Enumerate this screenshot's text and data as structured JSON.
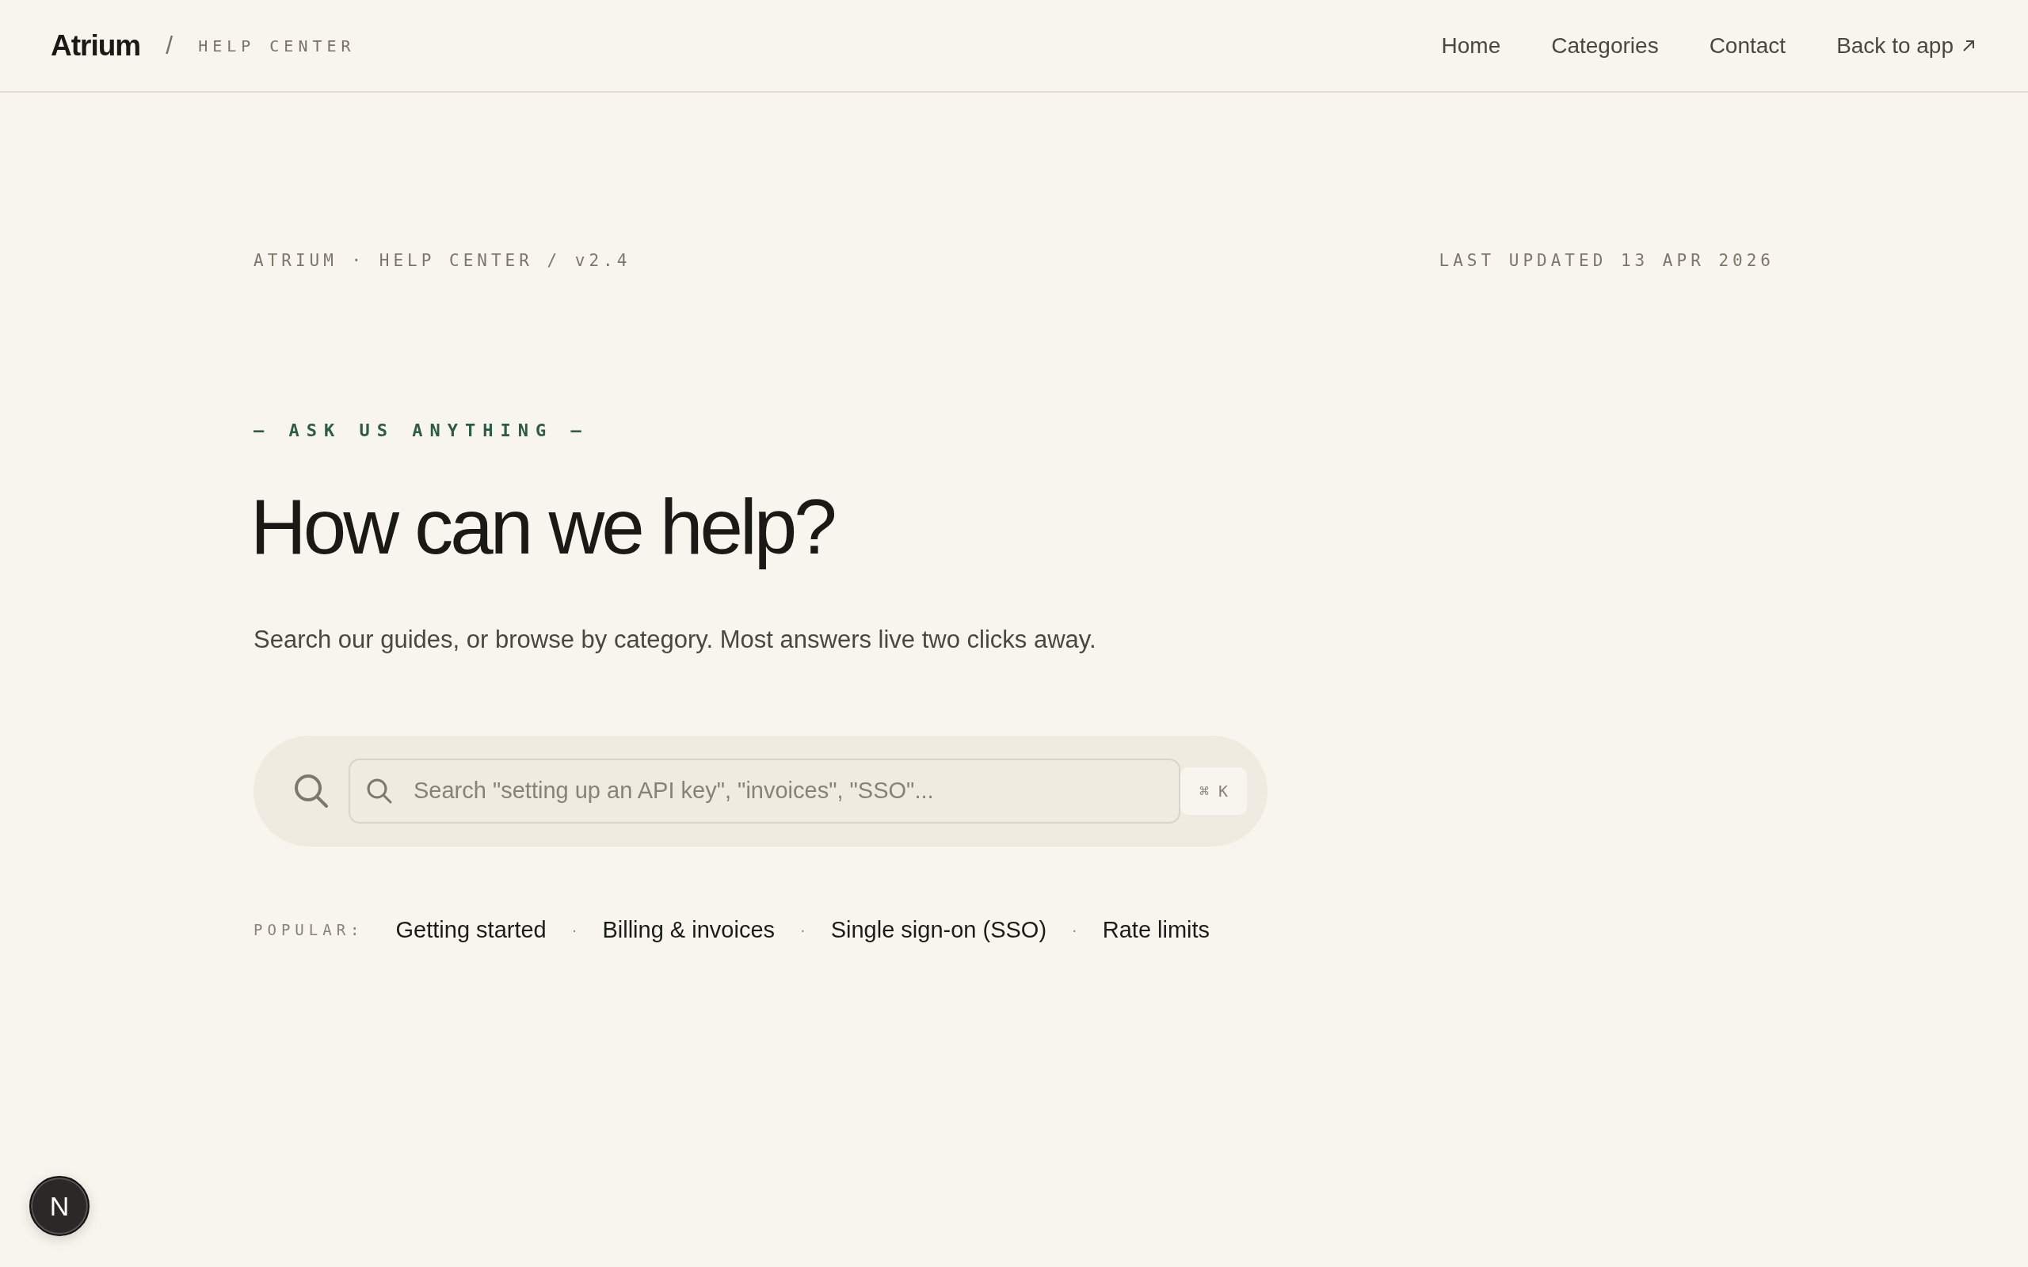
{
  "header": {
    "brand": "Atrium",
    "separator": "/",
    "section": "HELP CENTER",
    "nav": [
      {
        "label": "Home",
        "kind": "link"
      },
      {
        "label": "Categories",
        "kind": "link"
      },
      {
        "label": "Contact",
        "kind": "link"
      },
      {
        "label": "Back to app",
        "kind": "external"
      }
    ]
  },
  "meta": {
    "breadcrumb": "ATRIUM · HELP CENTER / v2.4",
    "updated": "LAST UPDATED 13 APR 2026"
  },
  "hero": {
    "eyebrow": "— ASK US ANYTHING —",
    "title": "How can we help?",
    "subtitle": "Search our guides, or browse by category. Most answers live two clicks away."
  },
  "search": {
    "placeholder": "Search \"setting up an API key\", \"invoices\", \"SSO\"...",
    "shortcut": "⌘ K"
  },
  "popular": {
    "label": "POPULAR:",
    "separator": "·",
    "links": [
      "Getting started",
      "Billing & invoices",
      "Single sign-on (SSO)",
      "Rate limits"
    ]
  },
  "badge": {
    "letter": "N"
  }
}
